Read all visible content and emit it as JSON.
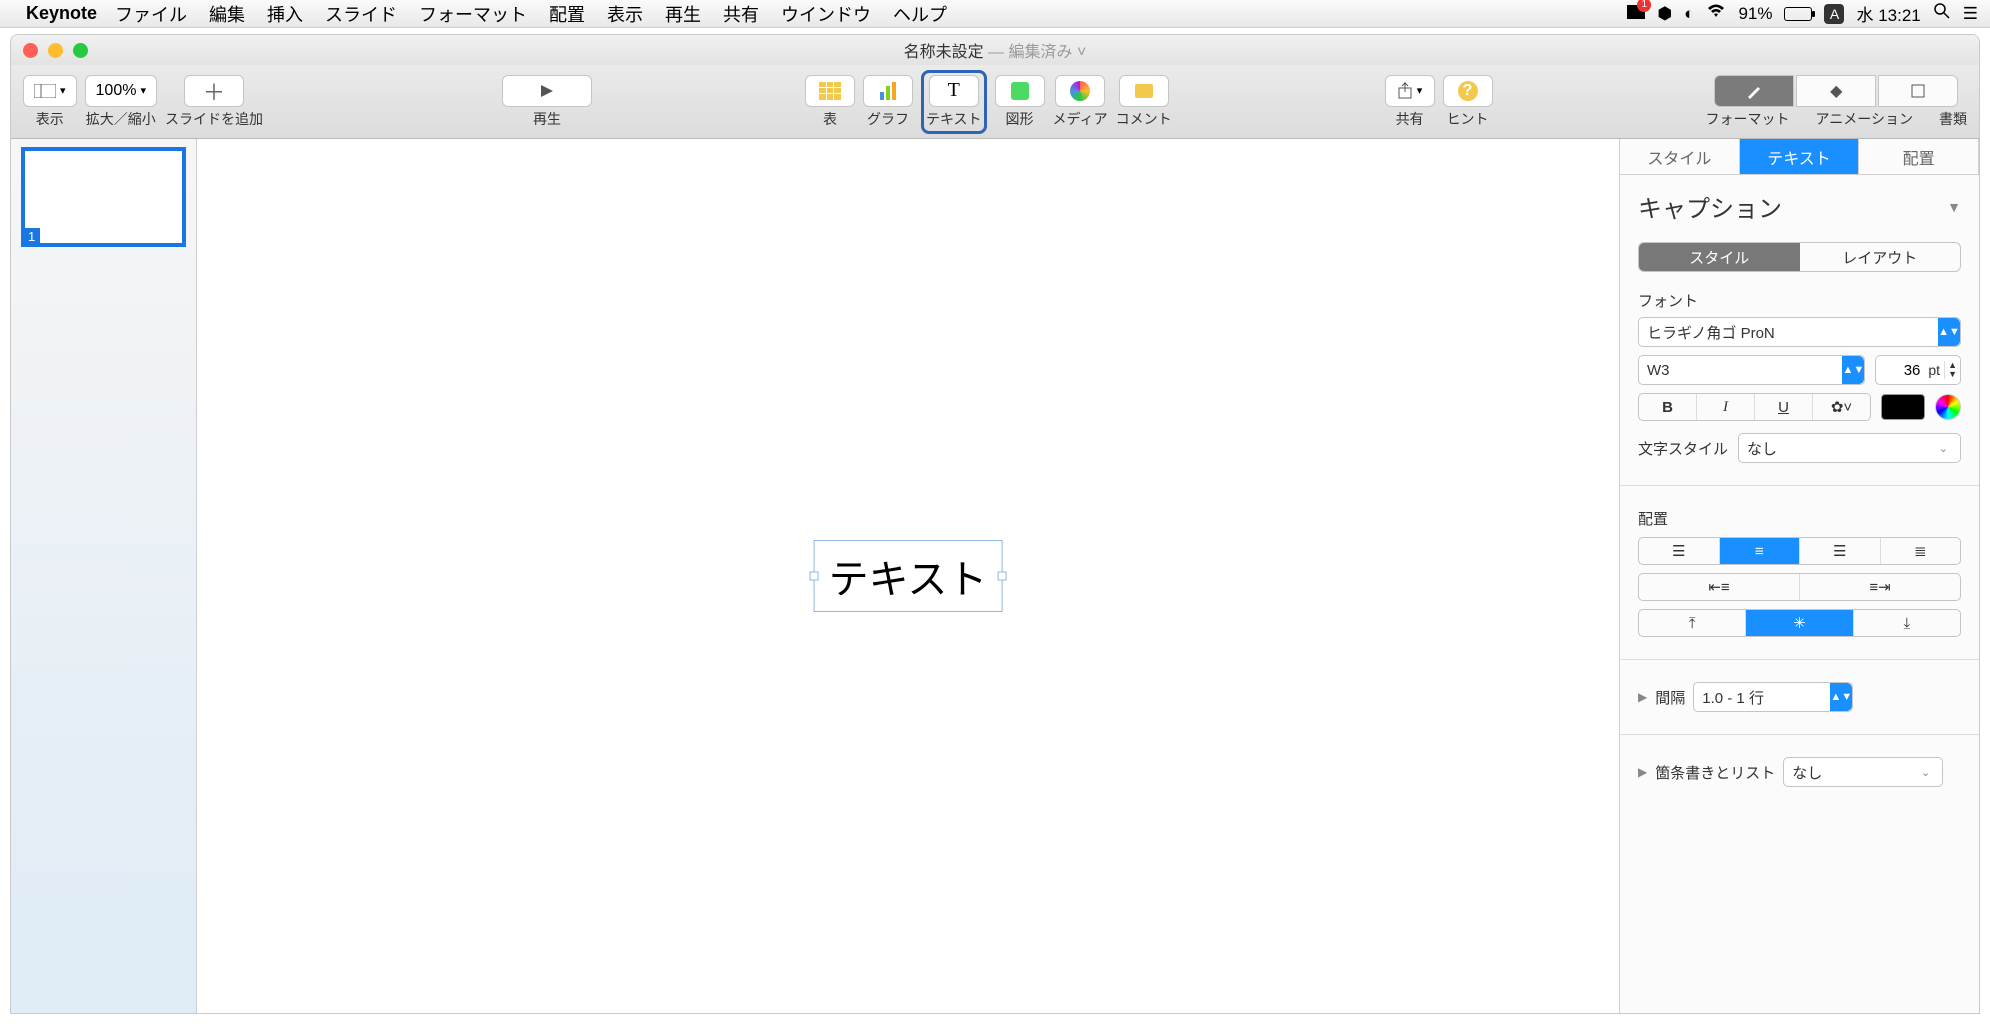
{
  "menubar": {
    "app": "Keynote",
    "items": [
      "ファイル",
      "編集",
      "挿入",
      "スライド",
      "フォーマット",
      "配置",
      "表示",
      "再生",
      "共有",
      "ウインドウ",
      "ヘルプ"
    ],
    "status": {
      "battery_pct": "91%",
      "input_badge": "A",
      "clock": "水 13:21",
      "mail_badge": "1"
    }
  },
  "window": {
    "title": "名称未設定",
    "subtitle": "— 編集済み",
    "chev": "˅"
  },
  "toolbar": {
    "view": "表示",
    "zoom_value": "100%",
    "zoom_label": "拡大／縮小",
    "add_slide": "スライドを追加",
    "play": "再生",
    "table": "表",
    "chart": "グラフ",
    "text": "テキスト",
    "shape": "図形",
    "media": "メディア",
    "comment": "コメント",
    "share": "共有",
    "hint": "ヒント",
    "format": "フォーマット",
    "animation": "アニメーション",
    "document": "書類"
  },
  "thumbs": {
    "slide1_num": "1"
  },
  "canvas": {
    "textbox": "テキスト"
  },
  "inspector": {
    "tabs": {
      "style": "スタイル",
      "text": "テキスト",
      "arrange": "配置"
    },
    "header": "キャプション",
    "subtabs": {
      "style": "スタイル",
      "layout": "レイアウト"
    },
    "font_label": "フォント",
    "font_family": "ヒラギノ角ゴ ProN",
    "font_weight": "W3",
    "font_size": "36",
    "font_unit": "pt",
    "bold": "B",
    "italic": "I",
    "underline": "U",
    "gear": "✿˅",
    "char_style_label": "文字スタイル",
    "char_style_value": "なし",
    "align_label": "配置",
    "spacing_label": "間隔",
    "spacing_value": "1.0 - 1 行",
    "bullets_label": "箇条書きとリスト",
    "bullets_value": "なし"
  }
}
